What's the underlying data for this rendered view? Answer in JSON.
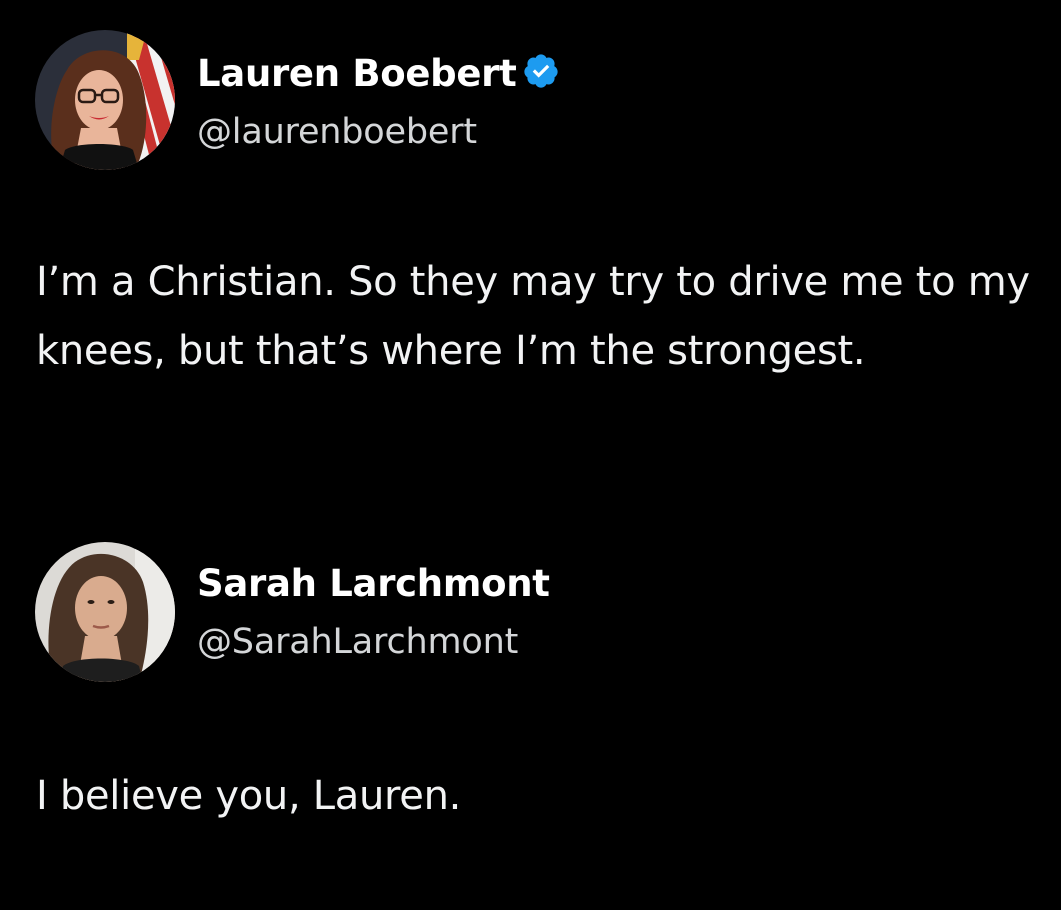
{
  "tweets": [
    {
      "author": {
        "display_name": "Lauren Boebert",
        "handle": "@laurenboebert",
        "verified": true,
        "avatar_icon": "profile-photo-woman-glasses-flag"
      },
      "text": "I’m a Christian. So they may try to drive me to my knees, but that’s where I’m the strongest."
    },
    {
      "author": {
        "display_name": "Sarah Larchmont",
        "handle": "@SarahLarchmont",
        "verified": false,
        "avatar_icon": "profile-photo-woman"
      },
      "text": "I believe you, Lauren."
    }
  ],
  "colors": {
    "background": "#000000",
    "name": "#ffffff",
    "handle": "#d4d6d8",
    "text": "#f2f3f4",
    "verified_badge": "#1d9bf0"
  }
}
